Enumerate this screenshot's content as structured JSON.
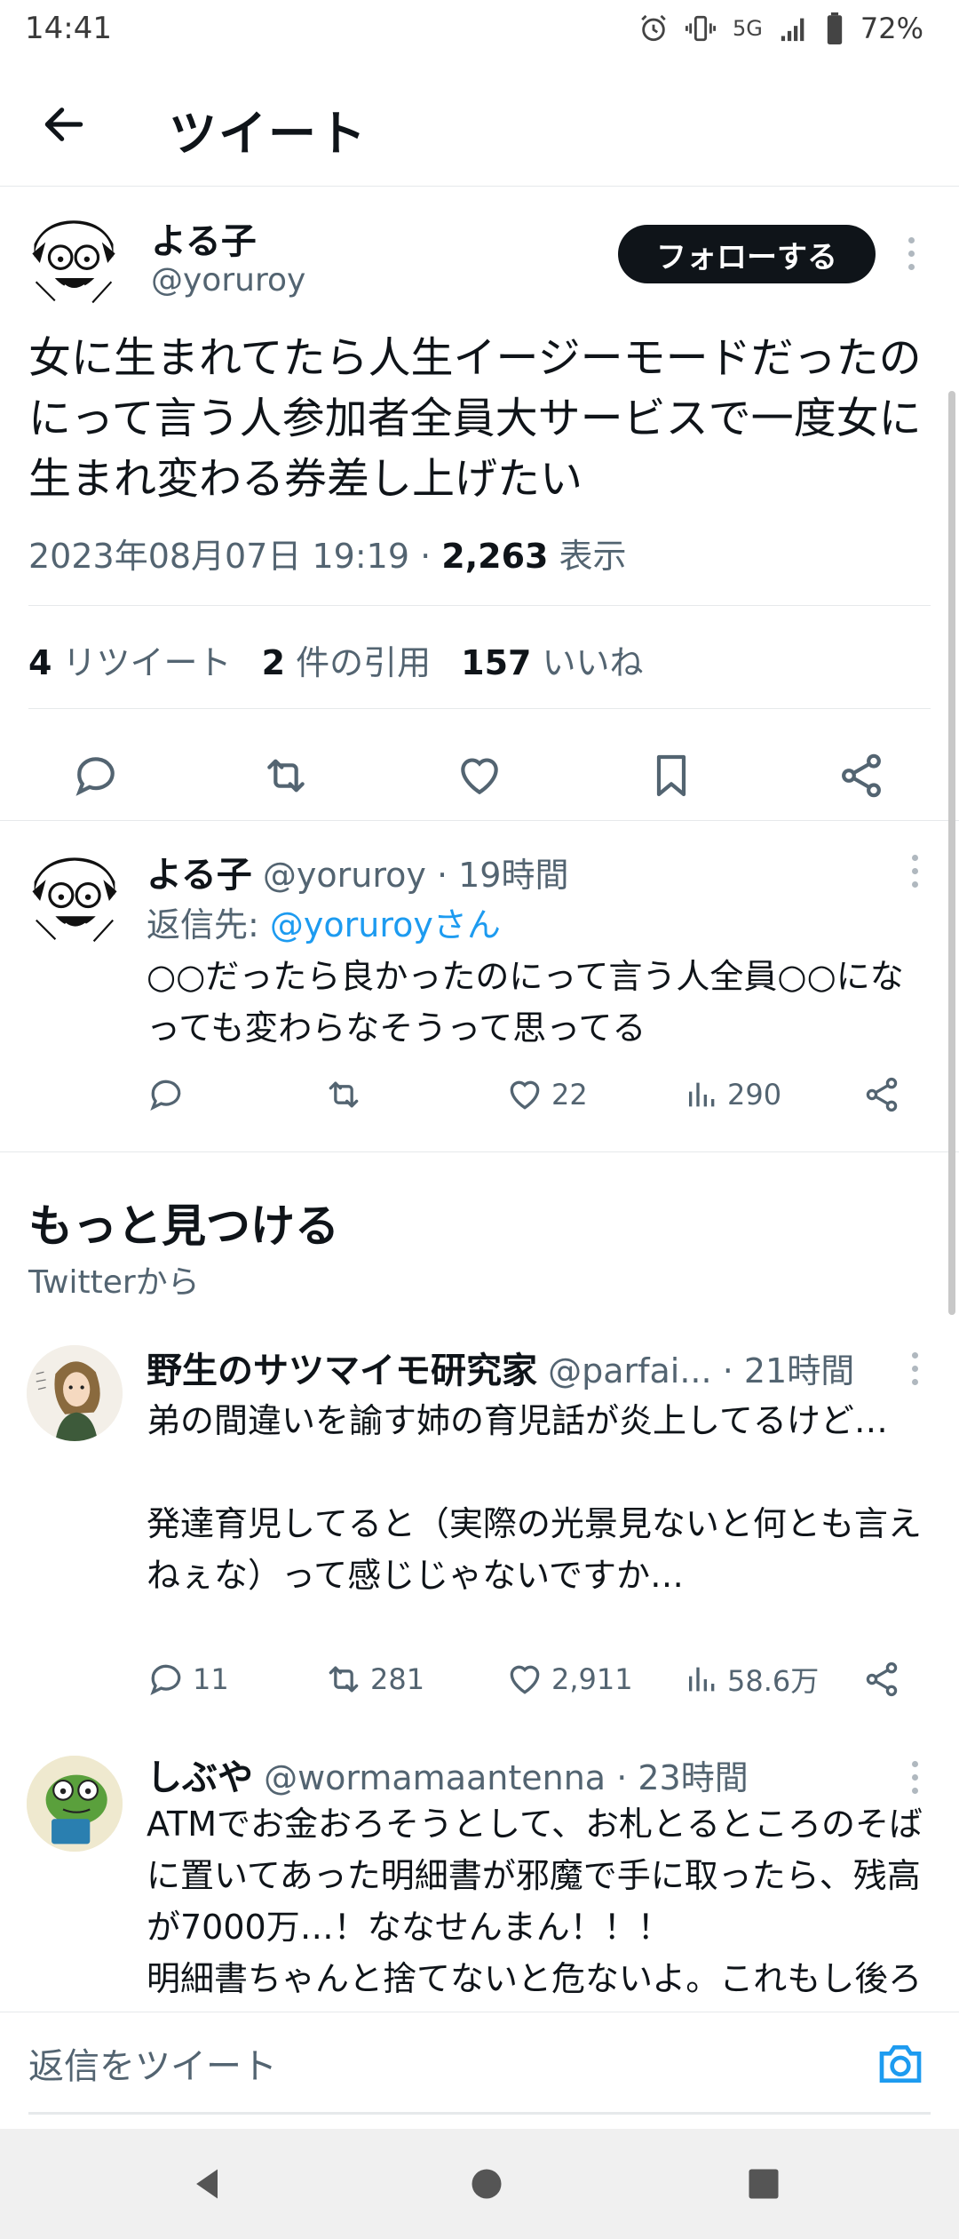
{
  "status_bar": {
    "time": "14:41",
    "network": "5G",
    "battery": "72%"
  },
  "header": {
    "title": "ツイート"
  },
  "main_tweet": {
    "name": "よる子",
    "handle": "@yoruroy",
    "follow_label": "フォローする",
    "text": "女に生まれてたら人生イージーモードだったのにって言う人参加者全員大サービスで一度女に生まれ変わる券差し上げたい",
    "date": "2023年08月07日 19:19 · ",
    "views_count": "2,263",
    "views_label": "表示",
    "retweets_count": "4",
    "retweets_label": "リツイート",
    "quotes_count": "2",
    "quotes_label": "件の引用",
    "likes_count": "157",
    "likes_label": "いいね"
  },
  "replies": [
    {
      "name": "よる子",
      "handle_time": "@yoruroy · 19時間",
      "reply_to_prefix": "返信先: ",
      "reply_to_handle": "@yoruroyさん",
      "text": "○○だったら良かったのにって言う人全員○○になっても変わらなそうって思ってる",
      "reply_count": "",
      "retweet_count": "",
      "like_count": "22",
      "view_count": "290"
    }
  ],
  "discover": {
    "title": "もっと見つける",
    "subtitle": "Twitterから",
    "tweets": [
      {
        "name": "野生のサツマイモ研究家",
        "handle": "@parfai...",
        "time": " · 21時間",
        "text": "弟の間違いを諭す姉の育児話が炎上してるけど…\n\n発達育児してると（実際の光景見ないと何とも言えねぇな）って感じじゃないですか…",
        "reply_count": "11",
        "retweet_count": "281",
        "like_count": "2,911",
        "view_count": "58.6万"
      },
      {
        "name": "しぶや",
        "handle": "@wormamaantenna",
        "time": " · 23時間",
        "text": "ATMでお金おろそうとして、お札とるところのそばに置いてあった明細書が邪魔で手に取ったら、残高が7000万…！ななせんまん！！！\n明細書ちゃんと捨てないと危ないよ。これもし後ろに人が並んでいて、それが悪い人だったら"
      }
    ]
  },
  "reply_bar": {
    "placeholder": "返信をツイート"
  },
  "colors": {
    "accent": "#1d9bf0",
    "text": "#0f1419",
    "muted": "#536471"
  }
}
